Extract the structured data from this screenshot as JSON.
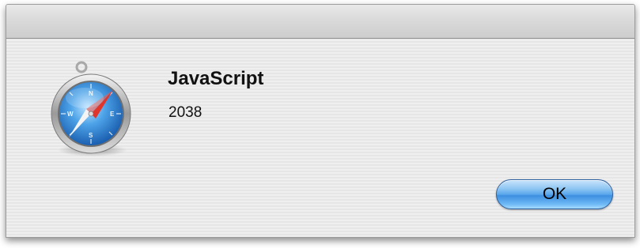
{
  "alert": {
    "title": "JavaScript",
    "message": "2038",
    "ok_label": "OK",
    "icon": "safari-compass-icon"
  },
  "colors": {
    "button_blue": "#5aa8ec",
    "compass_blue": "#3b8fd9",
    "needle_red": "#e0352b"
  }
}
